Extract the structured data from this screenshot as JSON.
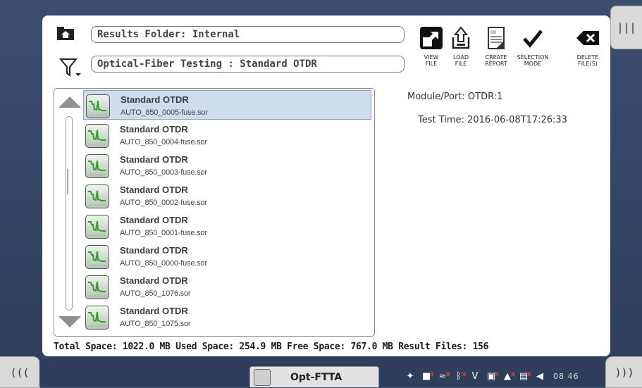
{
  "header": {
    "folder_label": "Results Folder: Internal",
    "filter_label": "Optical-Fiber Testing : Standard OTDR"
  },
  "toolbar": [
    {
      "label": "VIEW\nFILE",
      "icon": "view-file-icon"
    },
    {
      "label": "LOAD\nFILE",
      "icon": "load-file-icon"
    },
    {
      "label": "CREATE\nREPORT",
      "icon": "create-report-icon"
    },
    {
      "label": "SELECTION\nMODE",
      "icon": "checkmark-icon"
    },
    {
      "label": "DELETE\nFILE(S)",
      "icon": "delete-icon"
    }
  ],
  "files": [
    {
      "title": "Standard OTDR",
      "file": "AUTO_850_0005-fuse.sor",
      "selected": true
    },
    {
      "title": "Standard OTDR",
      "file": "AUTO_850_0004-fuse.sor",
      "selected": false
    },
    {
      "title": "Standard OTDR",
      "file": "AUTO_850_0003-fuse.sor",
      "selected": false
    },
    {
      "title": "Standard OTDR",
      "file": "AUTO_850_0002-fuse.sor",
      "selected": false
    },
    {
      "title": "Standard OTDR",
      "file": "AUTO_850_0001-fuse.sor",
      "selected": false
    },
    {
      "title": "Standard OTDR",
      "file": "AUTO_850_0000-fuse.sor",
      "selected": false
    },
    {
      "title": "Standard OTDR",
      "file": "AUTO_850_1076.sor",
      "selected": false
    },
    {
      "title": "Standard OTDR",
      "file": "AUTO_850_1075.sor",
      "selected": false
    }
  ],
  "details": {
    "module_port": "Module/Port: OTDR:1",
    "test_time": "Test Time: 2016-06-08T17:26:33"
  },
  "footer": {
    "stats": "Total Space: 1022.0 MB  Used Space: 254.9 MB  Free Space: 767.0 MB  Result Files: 156"
  },
  "side_tabs": {
    "right_top": "|||",
    "left_bottom": "(((",
    "right_bottom": ")))"
  },
  "taskbar": {
    "app_label": "Opt-FTTA",
    "clock": "08 46"
  },
  "colors": {
    "background": "#3e4f6e",
    "selection": "#cfdcee",
    "trace_green": "#33a02c"
  }
}
